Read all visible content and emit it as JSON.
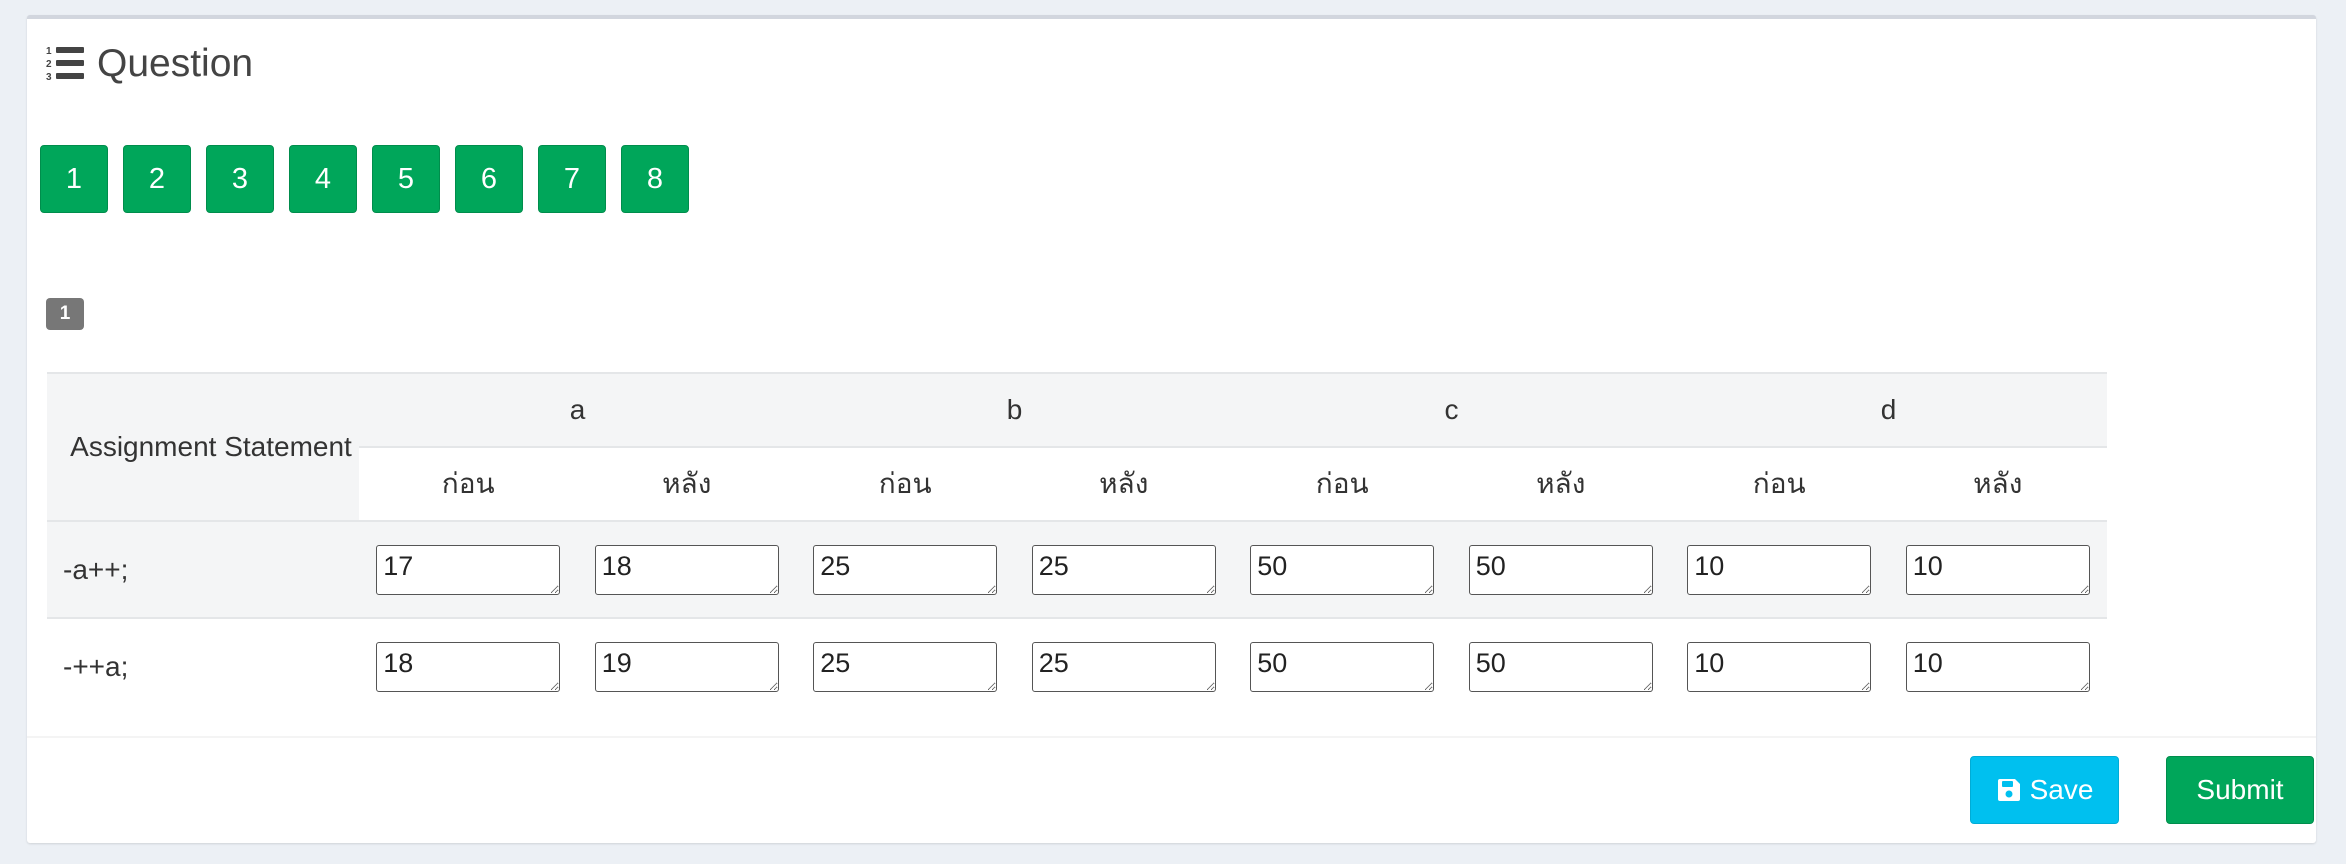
{
  "header": {
    "title": "Question",
    "icon": "list-ol-icon"
  },
  "question_nav": {
    "buttons": [
      "1",
      "2",
      "3",
      "4",
      "5",
      "6",
      "7",
      "8"
    ],
    "color": "#00a65a"
  },
  "current_question": {
    "badge": "1"
  },
  "table": {
    "statement_header": "Assignment Statement",
    "variables": [
      "a",
      "b",
      "c",
      "d"
    ],
    "before_label": "ก่อน",
    "after_label": "หลัง",
    "rows": [
      {
        "statement": "-a++;",
        "values": [
          "17",
          "18",
          "25",
          "25",
          "50",
          "50",
          "10",
          "10"
        ]
      },
      {
        "statement": "-++a;",
        "values": [
          "18",
          "19",
          "25",
          "25",
          "50",
          "50",
          "10",
          "10"
        ]
      }
    ]
  },
  "footer": {
    "save_label": "Save",
    "save_icon": "floppy-disk-icon",
    "save_color": "#00c0ef",
    "submit_label": "Submit",
    "submit_color": "#00a65a"
  }
}
